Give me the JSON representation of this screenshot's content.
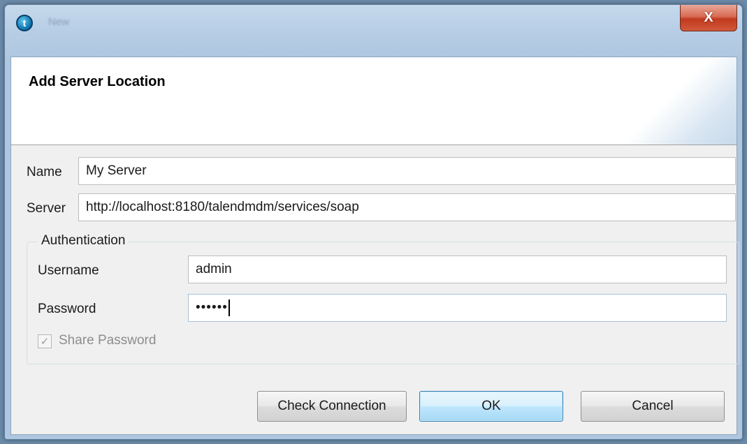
{
  "window": {
    "title": "New",
    "close_glyph": "X",
    "app_icon": "talend-logo-icon",
    "app_icon_glyph": "t"
  },
  "dialog": {
    "title": "Add Server Location",
    "fields": {
      "name": {
        "label": "Name",
        "value": "My Server"
      },
      "server": {
        "label": "Server",
        "value": "http://localhost:8180/talendmdm/services/soap"
      }
    },
    "authentication": {
      "legend": "Authentication",
      "username": {
        "label": "Username",
        "value": "admin"
      },
      "password": {
        "label": "Password",
        "value": "••••••"
      },
      "share_password": {
        "label": "Share Password",
        "checked": true,
        "enabled": false,
        "check_glyph": "✓"
      }
    },
    "buttons": {
      "check_connection": "Check Connection",
      "ok": "OK",
      "cancel": "Cancel"
    }
  },
  "colors": {
    "close_button": "#c13a1e",
    "default_button": "#3c7fb1",
    "window_frame": "#b6cde5"
  }
}
